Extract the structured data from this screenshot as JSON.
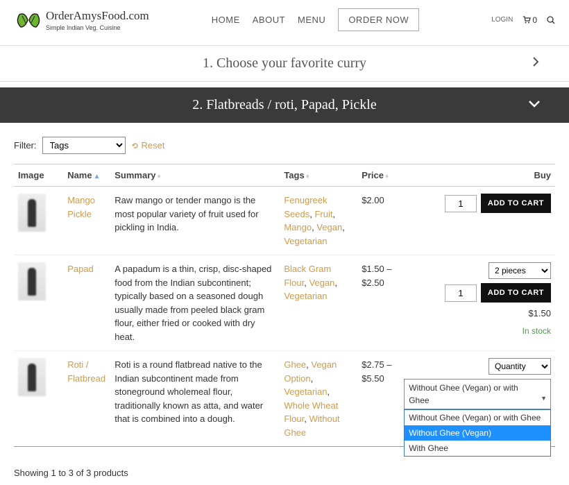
{
  "site": {
    "name": "OrderAmysFood.com",
    "tagline": "Simple Indian Veg. Cuisine"
  },
  "nav": {
    "home": "HOME",
    "about": "ABOUT",
    "menu": "MENU",
    "order_now": "ORDER NOW",
    "login": "LOGIN",
    "cart_count": "0"
  },
  "accordion": {
    "step1": "1. Choose your favorite curry",
    "step2": "2. Flatbreads / roti, Papad, Pickle"
  },
  "filter": {
    "label": "Filter:",
    "tags_option": "Tags",
    "reset": "Reset"
  },
  "columns": {
    "image": "Image",
    "name": "Name",
    "summary": "Summary",
    "tags": "Tags",
    "price": "Price",
    "buy": "Buy"
  },
  "products": [
    {
      "name": "Mango Pickle",
      "summary": "Raw mango or tender mango is the most popular variety of fruit used for pickling in India.",
      "tags": [
        "Fenugreek Seeds",
        "Fruit",
        "Mango",
        "Vegan",
        "Vegetarian"
      ],
      "price": "$2.00",
      "qty": "1",
      "add_label": "ADD TO CART"
    },
    {
      "name": "Papad",
      "summary": "A papadum is a thin, crisp, disc-shaped food from the Indian subcontinent; typically based on a seasoned dough usually made from peeled black gram flour, either fried or cooked with dry heat.",
      "tags": [
        "Black Gram Flour",
        "Vegan",
        "Vegetarian"
      ],
      "price": "$1.50 – $2.50",
      "variant_label": "2 pieces",
      "qty": "1",
      "add_label": "ADD TO CART",
      "unit_price": "$1.50",
      "stock": "In stock"
    },
    {
      "name": "Roti / Flatbread",
      "summary": "Roti is a round flatbread native to the Indian subcontinent made from stoneground wholemeal flour, traditionally known as atta, and water that is combined into a dough.",
      "tags": [
        "Ghee",
        "Vegan Option",
        "Vegetarian",
        "Whole Wheat Flour",
        "Without Ghee"
      ],
      "price": "$2.75 – $5.50",
      "qty_label": "Quantity",
      "ghee_selected": "Without Ghee (Vegan) or with Ghee",
      "ghee_options": [
        "Without Ghee (Vegan) or with Ghee",
        "Without Ghee (Vegan)",
        "With Ghee"
      ]
    }
  ],
  "footer": {
    "showing": "Showing 1 to 3 of 3 products"
  }
}
